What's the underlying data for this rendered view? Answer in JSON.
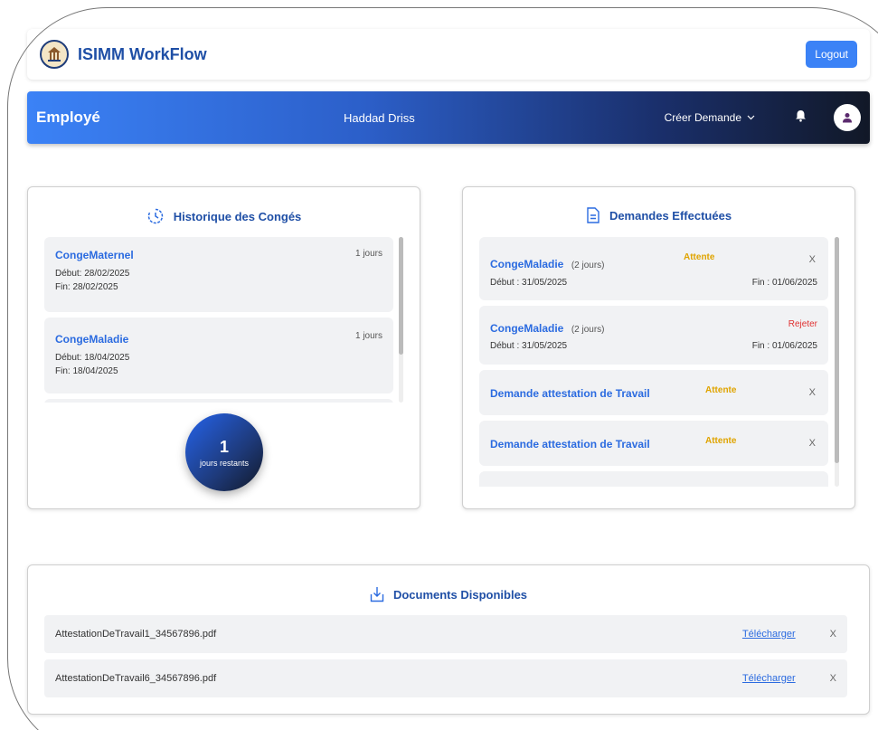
{
  "app": {
    "title": "ISIMM WorkFlow",
    "logout_label": "Logout"
  },
  "navbar": {
    "role": "Employé",
    "user_name": "Haddad Driss",
    "menu_label": "Créer Demande"
  },
  "history": {
    "title": "Historique des Congés",
    "items": [
      {
        "type": "CongeMaternel",
        "days": "1 jours",
        "start_label": "Début:",
        "start": "28/02/2025",
        "end_label": "Fin:",
        "end": "28/02/2025"
      },
      {
        "type": "CongeMaladie",
        "days": "1 jours",
        "start_label": "Début:",
        "start": "18/04/2025",
        "end_label": "Fin:",
        "end": "18/04/2025"
      }
    ],
    "remaining_value": "1",
    "remaining_label": "jours restants"
  },
  "requests": {
    "title": "Demandes Effectuées",
    "items": [
      {
        "type": "CongeMaladie",
        "duration": "(2 jours)",
        "status": "Attente",
        "start": "Début : 31/05/2025",
        "end": "Fin : 01/06/2025",
        "close": "X"
      },
      {
        "type": "CongeMaladie",
        "duration": "(2 jours)",
        "status": "Rejeter",
        "start": "Début : 31/05/2025",
        "end": "Fin : 01/06/2025"
      },
      {
        "type": "Demande attestation de Travail",
        "status": "Attente",
        "close": "X"
      },
      {
        "type": "Demande attestation de Travail",
        "status": "Attente",
        "close": "X"
      }
    ]
  },
  "documents": {
    "title": "Documents Disponibles",
    "items": [
      {
        "name": "AttestationDeTravail1_34567896.pdf",
        "link": "Télécharger",
        "close": "X"
      },
      {
        "name": "AttestationDeTravail6_34567896.pdf",
        "link": "Télécharger",
        "close": "X"
      }
    ]
  },
  "colors": {
    "accent": "#3b82f6",
    "title_blue": "#1f4fa6",
    "wait": "#e0a400",
    "reject": "#e03131"
  }
}
